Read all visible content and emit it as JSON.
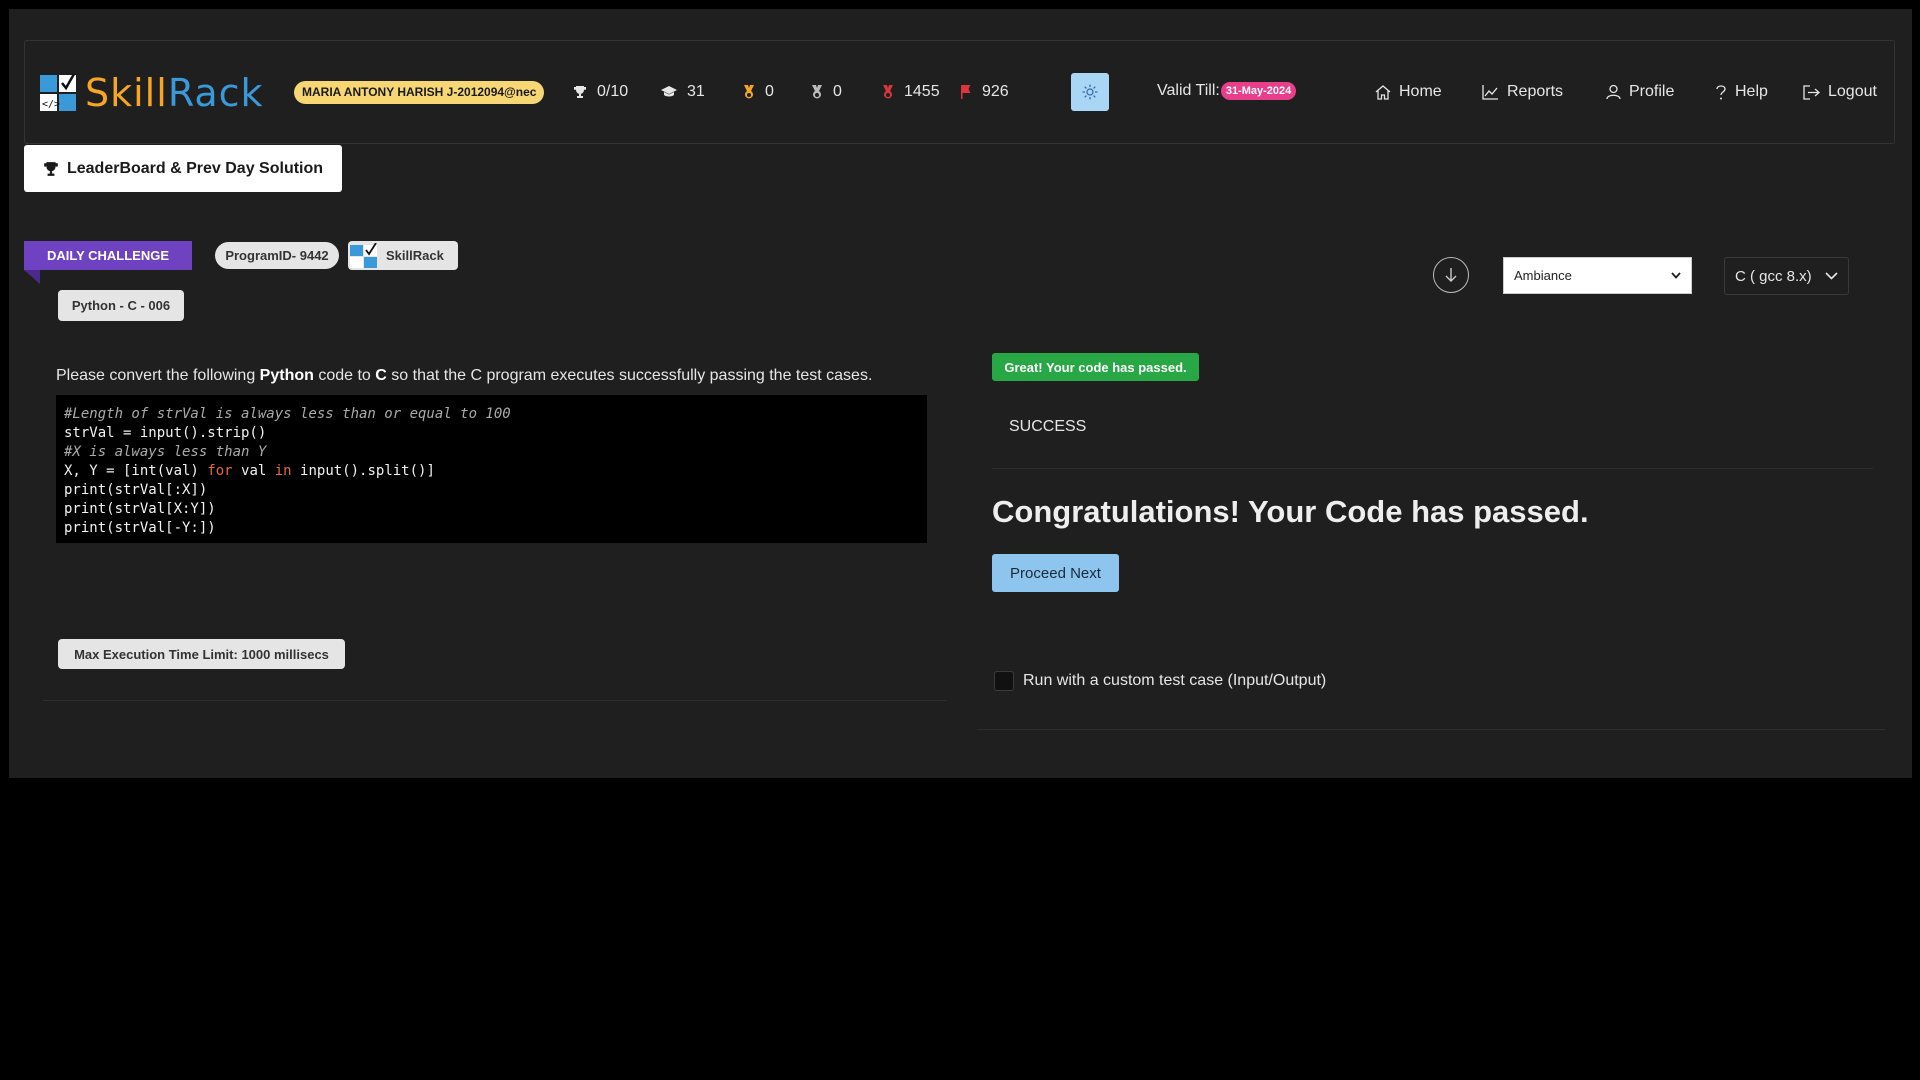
{
  "header": {
    "logo": {
      "part1": "Skill",
      "part2": "Rack"
    },
    "user": "MARIA ANTONY HARISH J-2012094@nec",
    "stats": [
      {
        "icon": "trophy-icon",
        "value": "0/10"
      },
      {
        "icon": "graduation-cap-icon",
        "value": "31"
      },
      {
        "icon": "gold-medal-icon",
        "value": "0"
      },
      {
        "icon": "silver-medal-icon",
        "value": "0"
      },
      {
        "icon": "red-medal-icon",
        "value": "1455"
      },
      {
        "icon": "flag-icon",
        "value": "926"
      }
    ],
    "valid_label": "Valid Till:",
    "valid_date": "31-May-2024",
    "nav": [
      {
        "label": "Home",
        "icon": "home-icon"
      },
      {
        "label": "Reports",
        "icon": "chart-icon"
      },
      {
        "label": "Profile",
        "icon": "user-icon"
      },
      {
        "label": "Help",
        "icon": "question-icon"
      },
      {
        "label": "Logout",
        "icon": "logout-icon"
      }
    ]
  },
  "leaderboard_button": "LeaderBoard & Prev Day Solution",
  "problem": {
    "ribbon": "DAILY CHALLENGE",
    "program_id": "ProgramID- 9442",
    "source_chip": "SkillRack",
    "tag": "Python - C - 006",
    "description": {
      "pre": "Please convert the following ",
      "lang_from": "Python",
      "mid": " code to ",
      "lang_to": "C",
      "post": " so that the C program executes successfully passing the test cases."
    },
    "code_lines": {
      "l1": "#Length of strVal is always less than or equal to 100",
      "l2": "strVal = input().strip()",
      "l3": "#X is always less than Y",
      "l4a": "X, Y = [int(val) ",
      "l4b": "for",
      "l4c": " val ",
      "l4d": "in",
      "l4e": " input().split()]",
      "l5": "print(strVal[:X])",
      "l6": "print(strVal[X:Y])",
      "l7": "print(strVal[-Y:])"
    },
    "time_limit": "Max Execution Time Limit: 1000 millisecs"
  },
  "editor": {
    "theme_select": "Ambiance",
    "language_select": "C ( gcc 8.x)"
  },
  "result": {
    "badge": "Great! Your code has passed.",
    "status": "SUCCESS",
    "heading": "Congratulations! Your Code has passed.",
    "proceed": "Proceed Next",
    "custom_label": "Run with a custom test case (Input/Output)"
  },
  "colors": {
    "accent_purple": "#6f42c1",
    "success_green": "#28a745",
    "date_pink": "#e83e8c",
    "proceed_blue": "#8ec5ee"
  }
}
